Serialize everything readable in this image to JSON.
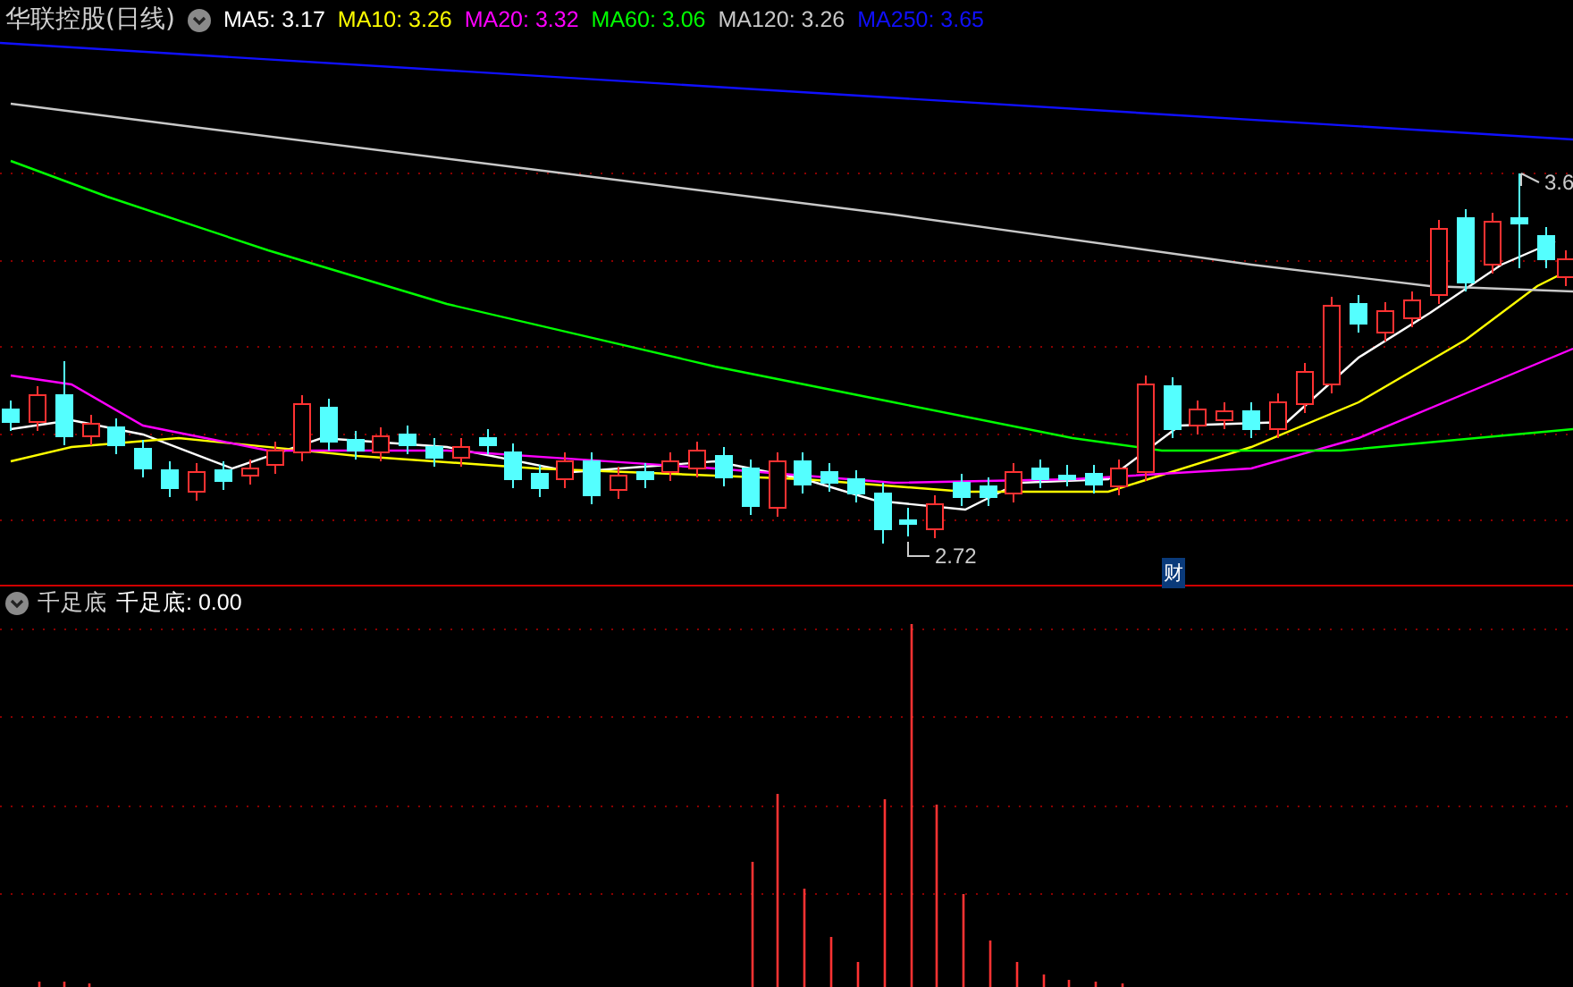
{
  "header": {
    "title": "华联控股(日线)",
    "indicators": [
      {
        "label": "MA5: 3.17",
        "color": "#ffffff"
      },
      {
        "label": "MA10: 3.26",
        "color": "#ffff00"
      },
      {
        "label": "MA20: 3.32",
        "color": "#ff00ff"
      },
      {
        "label": "MA60: 3.06",
        "color": "#00ff00"
      },
      {
        "label": "MA120: 3.26",
        "color": "#c8c8c8"
      },
      {
        "label": "MA250: 3.65",
        "color": "#1010ff"
      }
    ]
  },
  "price_chart": {
    "high_label": "3.6",
    "low_label": "2.72",
    "event_badge": "财"
  },
  "sub_panel": {
    "title": "千足底",
    "indicators": [
      {
        "label": "千足底: 0.00",
        "color": "#ffffff"
      }
    ]
  }
}
